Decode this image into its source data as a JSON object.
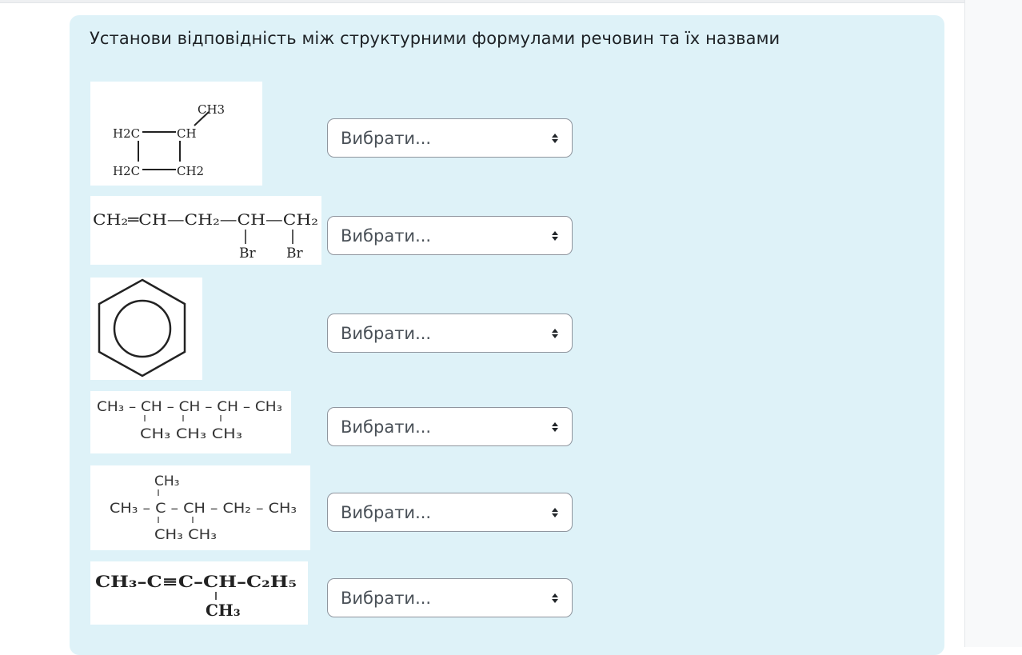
{
  "question": {
    "prompt": "Установи відповідність між структурними формулами речовин та їх назвами"
  },
  "select_placeholder": "Вибрати...",
  "formulas": [
    {
      "id": "methylcyclobutane",
      "texts": {
        "ch3": "CH3",
        "h2c_top": "H2C",
        "ch": "CH",
        "h2c_bottom": "H2C",
        "ch2": "CH2"
      }
    },
    {
      "id": "dibromopentene",
      "texts": {
        "chain": "CH₂═CH—CH₂—CH—CH₂",
        "br1": "Br",
        "br2": "Br"
      }
    },
    {
      "id": "benzene",
      "texts": {}
    },
    {
      "id": "trimethylpentane",
      "texts": {
        "main": "CH₃ – CH – CH – CH – CH₃",
        "subs": "CH₃  CH₃  CH₃"
      }
    },
    {
      "id": "tetramethylpentane",
      "texts": {
        "top": "CH₃",
        "main": "CH₃ – C  –  CH – CH₂ – CH₃",
        "subs": "CH₃  CH₃"
      }
    },
    {
      "id": "methylhexyne",
      "texts": {
        "main": "CH₃–C≡C–CH–C₂H₅",
        "sub": "CH₃"
      }
    }
  ]
}
